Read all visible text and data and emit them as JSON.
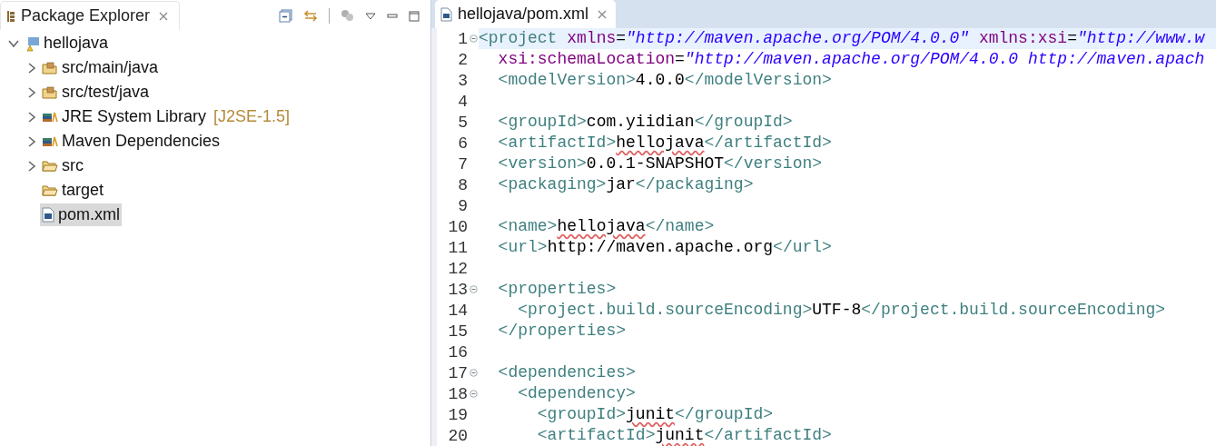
{
  "explorer": {
    "tab": {
      "label": "Package Explorer",
      "selected": true
    },
    "tree": [
      {
        "label": "hellojava",
        "kind": "project",
        "expanded": true,
        "selected": false,
        "children": [
          {
            "label": "src/main/java",
            "kind": "package-folder",
            "expanded": false,
            "selected": false
          },
          {
            "label": "src/test/java",
            "kind": "package-folder",
            "expanded": false,
            "selected": false
          },
          {
            "label": "JRE System Library",
            "decoration": "[J2SE-1.5]",
            "kind": "library",
            "expanded": false,
            "selected": false
          },
          {
            "label": "Maven Dependencies",
            "kind": "library",
            "expanded": false,
            "selected": false
          },
          {
            "label": "src",
            "kind": "folder",
            "expanded": false,
            "selected": false
          },
          {
            "label": "target",
            "kind": "folder",
            "selected": false
          },
          {
            "label": "pom.xml",
            "kind": "maven-file",
            "selected": true
          }
        ]
      }
    ]
  },
  "editor": {
    "tab": {
      "label": "hellojava/pom.xml",
      "selected": true
    },
    "lines": [
      {
        "number": "1",
        "foldable": true,
        "current": true,
        "tokens": [
          {
            "kind": "tag",
            "text": "<project"
          },
          {
            "kind": "attr",
            "text": " xmlns"
          },
          {
            "kind": "text",
            "text": "="
          },
          {
            "kind": "string",
            "text": "\"http://maven.apache.org/POM/4.0.0\""
          },
          {
            "kind": "attr",
            "text": " xmlns:xsi"
          },
          {
            "kind": "text",
            "text": "="
          },
          {
            "kind": "string",
            "text": "\"http://www.w"
          }
        ]
      },
      {
        "number": "2",
        "foldable": false,
        "current": false,
        "tokens": [
          {
            "kind": "attr",
            "text": "  xsi:schemaLocation"
          },
          {
            "kind": "text",
            "text": "="
          },
          {
            "kind": "string",
            "text": "\"http://maven.apache.org/POM/4.0.0 http://maven.apach"
          }
        ]
      },
      {
        "number": "3",
        "foldable": false,
        "current": false,
        "tokens": [
          {
            "kind": "tag",
            "text": "  <modelVersion>"
          },
          {
            "kind": "text",
            "text": "4.0.0"
          },
          {
            "kind": "tag",
            "text": "</modelVersion>"
          }
        ]
      },
      {
        "number": "4",
        "foldable": false,
        "current": false
      },
      {
        "number": "5",
        "foldable": false,
        "current": false,
        "tokens": [
          {
            "kind": "tag",
            "text": "  <groupId>"
          },
          {
            "kind": "text",
            "text": "com.yiidian"
          },
          {
            "kind": "tag",
            "text": "</groupId>"
          }
        ]
      },
      {
        "number": "6",
        "foldable": false,
        "current": false,
        "tokens": [
          {
            "kind": "tag",
            "text": "  <artifactId>"
          },
          {
            "kind": "text",
            "text": "hellojava",
            "misspelled": true
          },
          {
            "kind": "tag",
            "text": "</artifactId>"
          }
        ]
      },
      {
        "number": "7",
        "foldable": false,
        "current": false,
        "tokens": [
          {
            "kind": "tag",
            "text": "  <version>"
          },
          {
            "kind": "text",
            "text": "0.0.1-SNAPSHOT"
          },
          {
            "kind": "tag",
            "text": "</version>"
          }
        ]
      },
      {
        "number": "8",
        "foldable": false,
        "current": false,
        "tokens": [
          {
            "kind": "tag",
            "text": "  <packaging>"
          },
          {
            "kind": "text",
            "text": "jar"
          },
          {
            "kind": "tag",
            "text": "</packaging>"
          }
        ]
      },
      {
        "number": "9",
        "foldable": false,
        "current": false
      },
      {
        "number": "10",
        "foldable": false,
        "current": false,
        "tokens": [
          {
            "kind": "tag",
            "text": "  <name>"
          },
          {
            "kind": "text",
            "text": "hellojava",
            "misspelled": true
          },
          {
            "kind": "tag",
            "text": "</name>"
          }
        ]
      },
      {
        "number": "11",
        "foldable": false,
        "current": false,
        "tokens": [
          {
            "kind": "tag",
            "text": "  <url>"
          },
          {
            "kind": "text",
            "text": "http://maven.apache.org"
          },
          {
            "kind": "tag",
            "text": "</url>"
          }
        ]
      },
      {
        "number": "12",
        "foldable": false,
        "current": false
      },
      {
        "number": "13",
        "foldable": true,
        "current": false,
        "tokens": [
          {
            "kind": "tag",
            "text": "  <properties>"
          }
        ]
      },
      {
        "number": "14",
        "foldable": false,
        "current": false,
        "tokens": [
          {
            "kind": "tag",
            "text": "    <project.build.sourceEncoding>"
          },
          {
            "kind": "text",
            "text": "UTF-8"
          },
          {
            "kind": "tag",
            "text": "</project.build.sourceEncoding>"
          }
        ]
      },
      {
        "number": "15",
        "foldable": false,
        "current": false,
        "tokens": [
          {
            "kind": "tag",
            "text": "  </properties>"
          }
        ]
      },
      {
        "number": "16",
        "foldable": false,
        "current": false
      },
      {
        "number": "17",
        "foldable": true,
        "current": false,
        "tokens": [
          {
            "kind": "tag",
            "text": "  <dependencies>"
          }
        ]
      },
      {
        "number": "18",
        "foldable": true,
        "current": false,
        "tokens": [
          {
            "kind": "tag",
            "text": "    <dependency>"
          }
        ]
      },
      {
        "number": "19",
        "foldable": false,
        "current": false,
        "tokens": [
          {
            "kind": "tag",
            "text": "      <groupId>"
          },
          {
            "kind": "text",
            "text": "junit",
            "misspelled": true
          },
          {
            "kind": "tag",
            "text": "</groupId>"
          }
        ]
      },
      {
        "number": "20",
        "foldable": false,
        "current": false,
        "tokens": [
          {
            "kind": "tag",
            "text": "      <artifactId>"
          },
          {
            "kind": "text",
            "text": "junit",
            "misspelled": true
          },
          {
            "kind": "tag",
            "text": "</artifactId>"
          }
        ]
      }
    ]
  }
}
